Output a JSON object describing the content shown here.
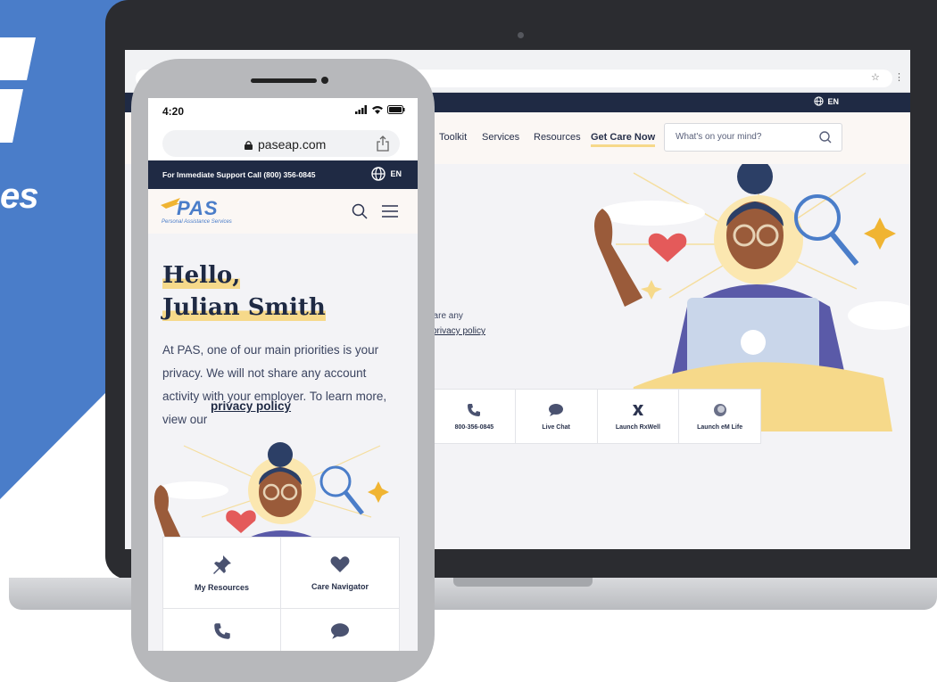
{
  "brand": {
    "fragment_text": "es",
    "blue": "#4a7dc9",
    "navy": "#1f2a44",
    "yellow": "#f6d98a"
  },
  "desktop": {
    "lang": "EN",
    "nav": [
      {
        "label": "Toolkit"
      },
      {
        "label": "Services"
      },
      {
        "label": "Resources"
      },
      {
        "label": "Get Care Now",
        "active": true
      }
    ],
    "search_placeholder": "What's on your mind?",
    "hero_line1": "hare any",
    "hero_link": "privacy policy",
    "tiles": [
      {
        "icon": "phone-icon",
        "label": "800-356-0845"
      },
      {
        "icon": "chat-icon",
        "label": "Live Chat"
      },
      {
        "icon": "rxwell-icon",
        "label": "Launch RxWell"
      },
      {
        "icon": "emlife-icon",
        "label": "Launch eM Life"
      }
    ]
  },
  "mobile": {
    "time": "4:20",
    "url": "paseap.com",
    "support": "For Immediate Support Call (800) 356-0845",
    "lang": "EN",
    "logo_text": "PAS",
    "logo_subtitle": "Personal Assistance Services",
    "greeting_line1": "Hello,",
    "greeting_line2": "Julian Smith",
    "privacy_text": "At PAS, one of our main priorities is your privacy. We will not share any account activity with your employer. To learn more, view our",
    "privacy_link": "privacy policy",
    "tiles": [
      {
        "icon": "pin-icon",
        "label": "My Resources"
      },
      {
        "icon": "heart-icon",
        "label": "Care Navigator"
      },
      {
        "icon": "phone-icon",
        "label": ""
      },
      {
        "icon": "chat-icon",
        "label": ""
      }
    ]
  }
}
